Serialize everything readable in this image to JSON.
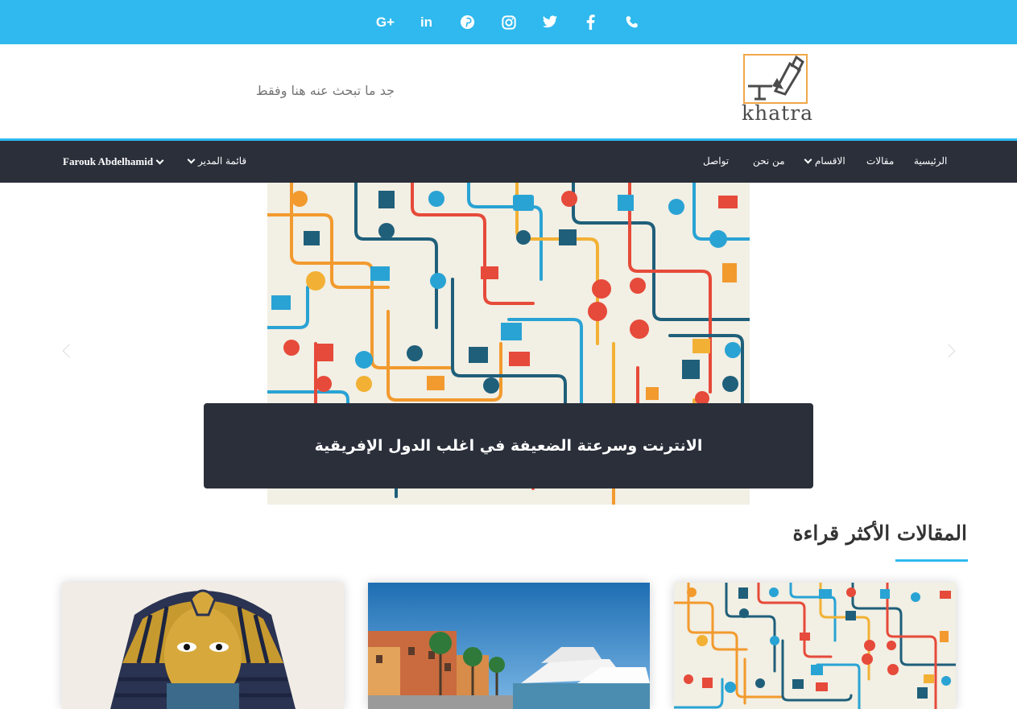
{
  "topbar": {
    "social_icons": [
      "google-plus-icon",
      "linkedin-icon",
      "pinterest-icon",
      "instagram-icon",
      "twitter-icon",
      "facebook-icon",
      "phone-icon"
    ],
    "color": "#2fb9ee"
  },
  "header": {
    "search_placeholder": "جد ما تبحث عنه هنا وفقط",
    "logo_text": "khatra"
  },
  "nav": {
    "items": [
      {
        "label": "الرئيسية"
      },
      {
        "label": "مقالات"
      },
      {
        "label": "الاقسام"
      },
      {
        "label": "من نحن"
      },
      {
        "label": "تواصل"
      }
    ],
    "admin_menu": "قائمة المدير",
    "user_name": "Farouk Abdelhamid"
  },
  "hero": {
    "caption": "الانترنت وسرعتة الضعيفة في اغلب الدول الإفريقية"
  },
  "most_read": {
    "title": "المقالات الأكثر قراءة"
  },
  "colors": {
    "accent": "#2fb9ee",
    "dark": "#2a2f3a"
  }
}
